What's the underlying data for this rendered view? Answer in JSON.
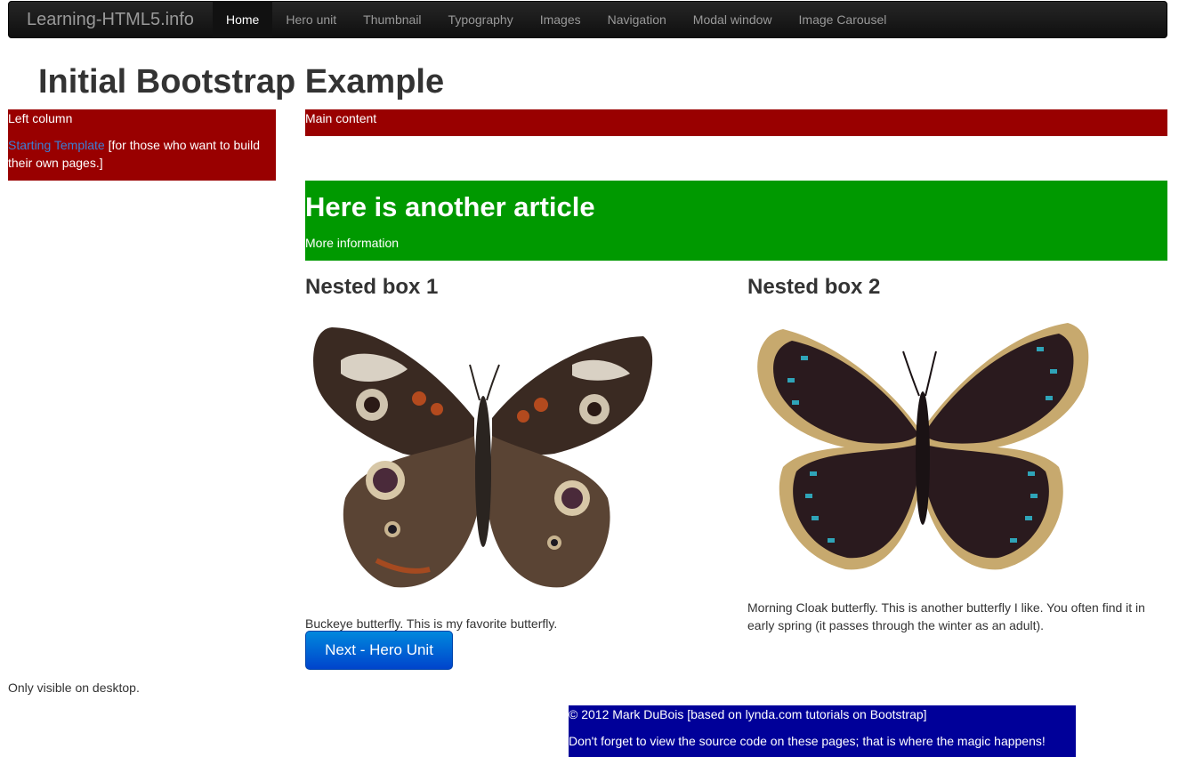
{
  "navbar": {
    "brand": "Learning-HTML5.info",
    "items": [
      {
        "label": "Home",
        "active": true
      },
      {
        "label": "Hero unit",
        "active": false
      },
      {
        "label": "Thumbnail",
        "active": false
      },
      {
        "label": "Typography",
        "active": false
      },
      {
        "label": "Images",
        "active": false
      },
      {
        "label": "Navigation",
        "active": false
      },
      {
        "label": "Modal window",
        "active": false
      },
      {
        "label": "Image Carousel",
        "active": false
      }
    ]
  },
  "page": {
    "title": "Initial Bootstrap Example"
  },
  "left_column": {
    "label": "Left column",
    "link_text": "Starting Template",
    "link_suffix": " [for those who want to build their own pages.]"
  },
  "main": {
    "label": "Main content",
    "article_title": "Here is another article",
    "article_text": "More information"
  },
  "nested": [
    {
      "title": "Nested box 1",
      "caption": "Buckeye butterfly. This is my favorite butterfly."
    },
    {
      "title": "Nested box 2",
      "caption": "Morning Cloak butterfly. This is another butterfly I like. You often find it in early spring (it passes through the winter as an adult)."
    }
  ],
  "button": {
    "label": "Next - Hero Unit"
  },
  "desktop_note": "Only visible on desktop.",
  "footer": {
    "line1": "© 2012 Mark DuBois [based on lynda.com tutorials on Bootstrap]",
    "line2": "Don't forget to view the source code on these pages; that is where the magic happens!"
  },
  "colors": {
    "left_bg": "#990000",
    "main_bg": "#990000",
    "article_bg": "#009900",
    "footer_bg": "#000099",
    "button_bg": "#0066cc"
  }
}
